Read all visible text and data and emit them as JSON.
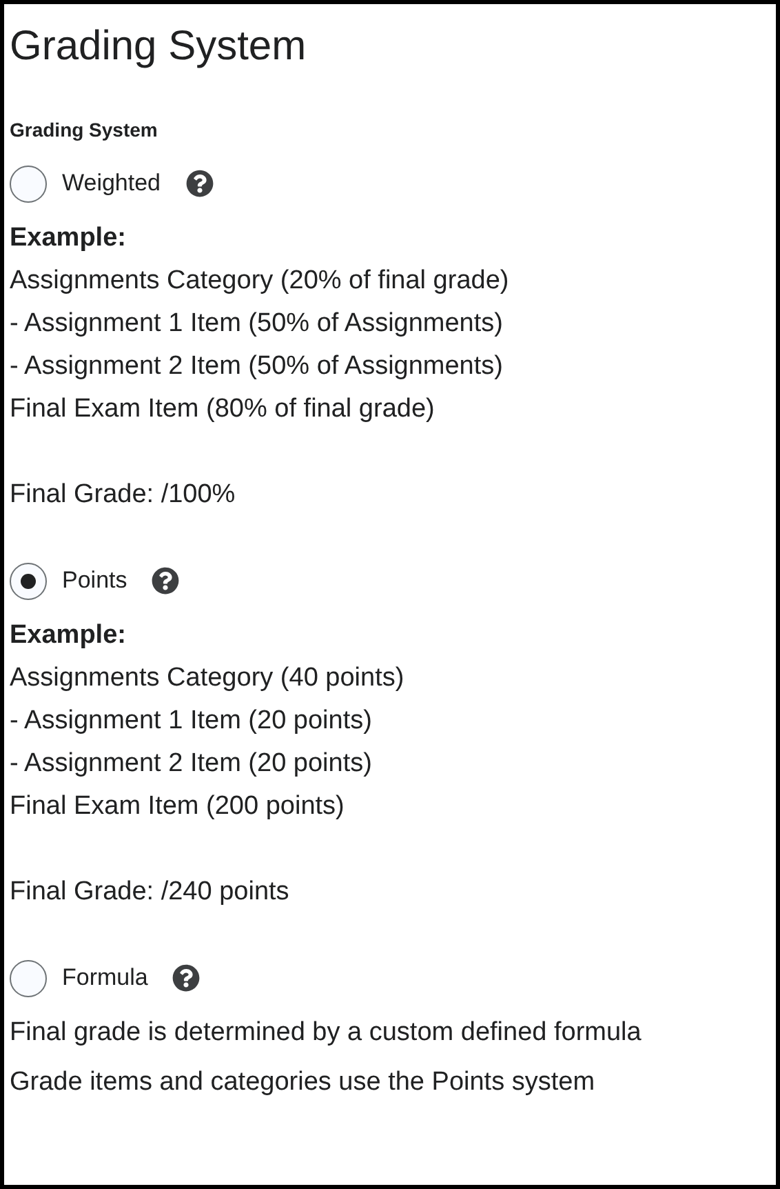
{
  "title": "Grading System",
  "section_label": "Grading System",
  "options": [
    {
      "label": "Weighted",
      "selected": false,
      "example_heading": "Example:",
      "lines": [
        "Assignments Category (20% of final grade)",
        "- Assignment 1 Item (50% of Assignments)",
        "- Assignment 2 Item (50% of Assignments)",
        "Final Exam Item (80% of final grade)"
      ],
      "final": "Final Grade: /100%"
    },
    {
      "label": "Points",
      "selected": true,
      "example_heading": "Example:",
      "lines": [
        "Assignments Category (40 points)",
        "- Assignment 1 Item (20 points)",
        "- Assignment 2 Item (20 points)",
        "Final Exam Item (200 points)"
      ],
      "final": "Final Grade: /240 points"
    },
    {
      "label": "Formula",
      "selected": false,
      "lines": [
        "Final grade is determined by a custom defined formula",
        "Grade items and categories use the Points system"
      ]
    }
  ]
}
